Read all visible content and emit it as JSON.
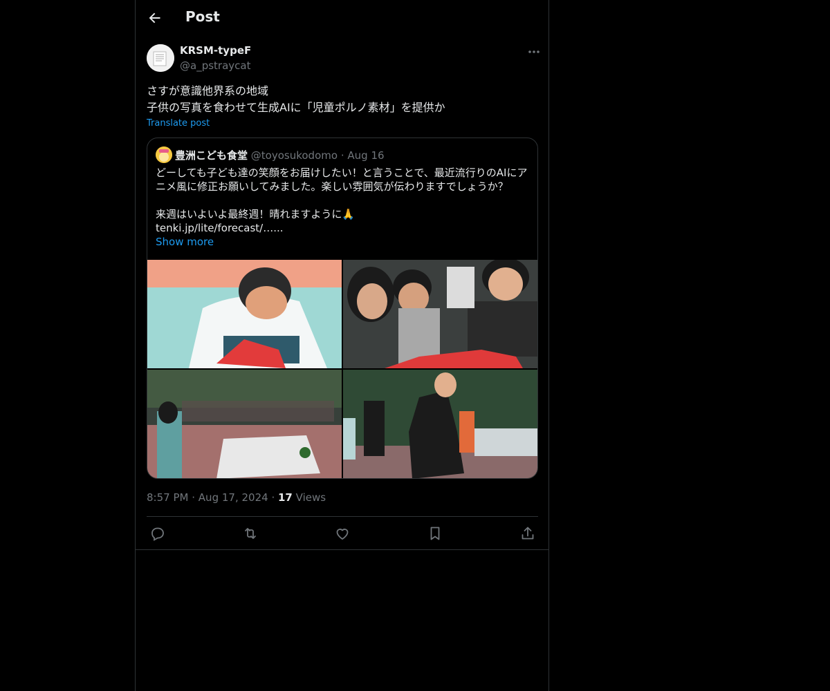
{
  "header": {
    "title": "Post",
    "back_icon": "back-arrow-icon"
  },
  "post": {
    "author_name": "KRSM-typeF",
    "author_handle": "@a_pstraycat",
    "text_lines": [
      "さすが意識他界系の地域",
      "子供の写真を食わせて生成AIに「児童ポルノ素材」を提供か"
    ],
    "translate_label": "Translate post",
    "time": "8:57 PM",
    "sep1": "·",
    "date": "Aug 17, 2024",
    "sep2": "·",
    "views_count": "17",
    "views_label": "Views"
  },
  "quote": {
    "author_name": "豊洲こども食堂",
    "author_handle": "@toyosukodomo",
    "sep": "·",
    "date": "Aug 16",
    "lines": [
      "どーしても子ども達の笑顔をお届けしたい！と言うことで、最近流行りのAIにア",
      "ニメ風に修正お願いしてみました。楽しい雰囲気が伝わりますでしょうか？",
      "",
      "来週はいよいよ最終週！晴れますように🙏",
      "tenki.jp/lite/forecast/…..."
    ],
    "show_more": "Show more"
  },
  "actions": [
    {
      "name": "reply-icon"
    },
    {
      "name": "repost-icon"
    },
    {
      "name": "like-icon"
    },
    {
      "name": "bookmark-icon"
    },
    {
      "name": "share-icon"
    }
  ],
  "colors": {
    "accent": "#1d9bf0",
    "muted": "#71767b",
    "border": "#2f3336",
    "text": "#e7e9ea"
  }
}
